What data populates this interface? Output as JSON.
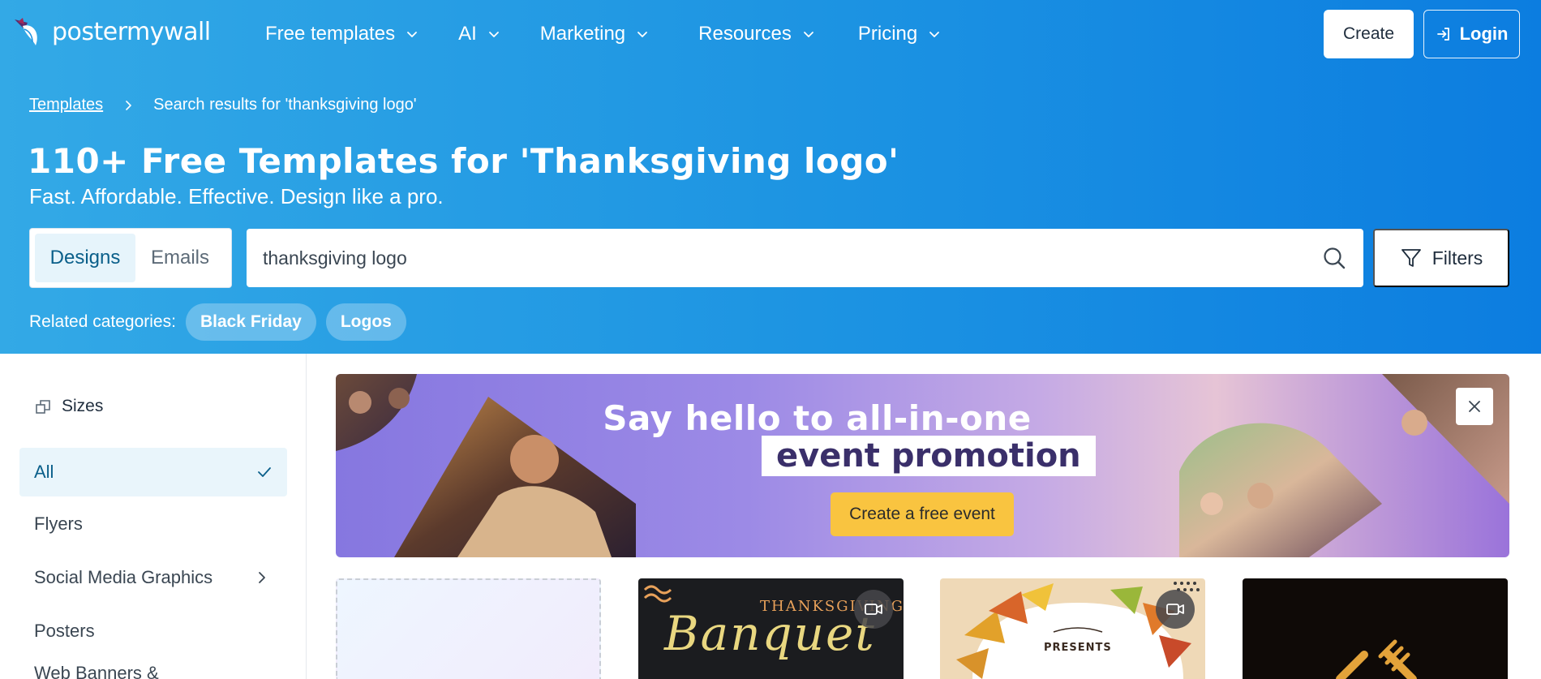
{
  "brand": {
    "name": "postermywall"
  },
  "nav": {
    "items": [
      {
        "label": "Free templates"
      },
      {
        "label": "AI"
      },
      {
        "label": "Marketing"
      },
      {
        "label": "Resources"
      },
      {
        "label": "Pricing"
      }
    ],
    "create_label": "Create",
    "login_label": "Login"
  },
  "breadcrumb": {
    "root": "Templates",
    "current": "Search results for 'thanksgiving logo'"
  },
  "header": {
    "title": "110+ Free Templates for 'Thanksgiving logo'",
    "subtitle": "Fast. Affordable. Effective. Design like a pro."
  },
  "search": {
    "tabs": [
      {
        "label": "Designs",
        "active": true
      },
      {
        "label": "Emails",
        "active": false
      }
    ],
    "query": "thanksgiving logo",
    "filters_label": "Filters"
  },
  "related": {
    "label": "Related categories:",
    "chips": [
      "Black Friday",
      "Logos"
    ]
  },
  "sidebar": {
    "heading": "Sizes",
    "items": [
      {
        "label": "All",
        "active": true
      },
      {
        "label": "Flyers"
      },
      {
        "label": "Social Media Graphics",
        "has_submenu": true
      },
      {
        "label": "Posters"
      },
      {
        "label": "Web Banners &"
      }
    ]
  },
  "banner": {
    "title_line1": "Say hello to all-in-one",
    "title_line2": "event promotion",
    "cta": "Create a free event"
  },
  "cards": [
    {
      "type": "blank"
    },
    {
      "type": "template",
      "video": true,
      "top_text": "THANKSGIVING",
      "script_text": "Banquet"
    },
    {
      "type": "template",
      "video": true,
      "small_text": "PRESENTS"
    },
    {
      "type": "template",
      "video": false
    }
  ],
  "colors": {
    "hero_start": "#33a9e6",
    "hero_end": "#0c7de0",
    "accent_cta": "#f9c440",
    "active_tab_bg": "#e6f4fb",
    "active_text": "#0a5f8a"
  }
}
